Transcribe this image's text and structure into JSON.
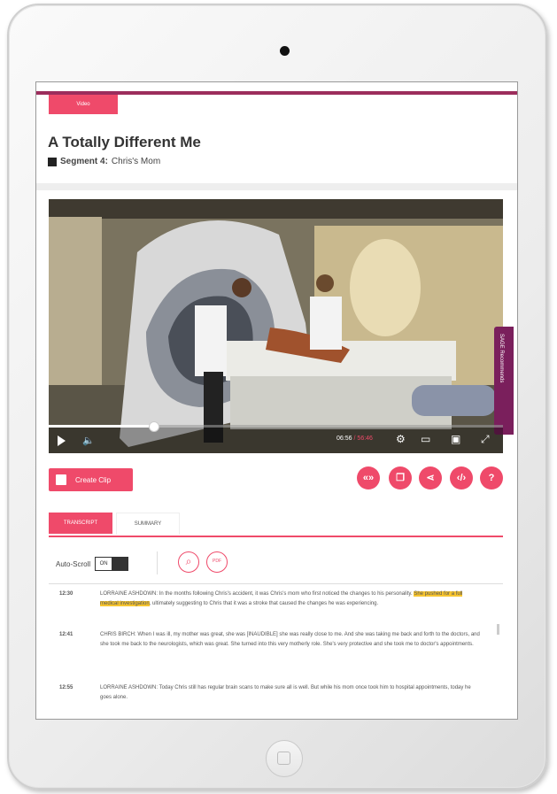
{
  "header": {
    "tag_label": "Video",
    "title": "A Totally Different Me",
    "segment_label": "Segment 4:",
    "segment_name": "Chris's Mom"
  },
  "player": {
    "side_tab_label": "SAGE Recommends",
    "progress": 0.23,
    "time_current": "06:56",
    "time_total": "/ 56:46"
  },
  "actions": {
    "create_clip_label": "Create Clip",
    "buttons": [
      "embed",
      "copy",
      "share",
      "code",
      "help"
    ]
  },
  "tabs": {
    "transcript": "TRANSCRIPT",
    "summary": "SUMMARY"
  },
  "toolbar": {
    "autoscroll_label": "Auto-Scroll",
    "toggle_state": "ON",
    "pdf_label": "PDF"
  },
  "transcript": [
    {
      "time": "12:30",
      "text_before": "LORRAINE ASHDOWN: In the months following Chris's accident, it was Chris's mom who first noticed the changes to his personality. ",
      "highlight": "She pushed for a full medical investigation",
      "text_after": ", ultimately suggesting to Chris that it was a stroke that caused the changes he was experiencing."
    },
    {
      "time": "12:41",
      "text": "CHRIS BIRCH: When I was ill, my mother was great, she was [INAUDIBLE] she was really close to me. And she was taking me back and forth to the doctors, and she took me back to the neurologists, which was great. She turned into this very motherly role. She's very protective and she took me to doctor's appointments."
    },
    {
      "time": "12:55",
      "text": "LORRAINE ASHDOWN: Today Chris still has regular brain scans to make sure all is well. But while his mom once took him to hospital appointments, today he goes alone."
    }
  ],
  "colors": {
    "accent": "#ef4a6a",
    "top_bar": "#9c2d5c",
    "side_tab": "#7a1f5c",
    "highlight": "#f7c530"
  }
}
